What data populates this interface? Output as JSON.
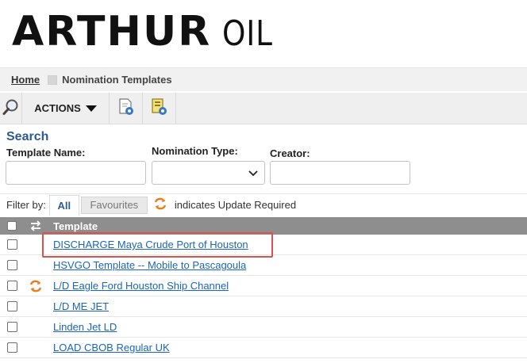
{
  "brand": {
    "part1": "ARTHUR",
    "part2": "OIL"
  },
  "breadcrumb": {
    "home": "Home",
    "current": "Nomination Templates"
  },
  "toolbar": {
    "actions_label": "ACTIONS"
  },
  "search": {
    "title": "Search",
    "template_name_label": "Template Name:",
    "template_name_value": "",
    "nomination_type_label": "Nomination Type:",
    "nomination_type_value": "",
    "creator_label": "Creator:",
    "creator_value": ""
  },
  "filter": {
    "label": "Filter by:",
    "all": "All",
    "favourites": "Favourites",
    "legend_text": "indicates Update Required"
  },
  "grid": {
    "column_template": "Template",
    "rows": [
      {
        "name": "DISCHARGE Maya Crude Port of Houston",
        "update_required": false
      },
      {
        "name": "HSVGO Template -- Mobile to Pascagoula",
        "update_required": false
      },
      {
        "name": "L/D Eagle Ford Houston Ship Channel",
        "update_required": true
      },
      {
        "name": "L/D ME JET",
        "update_required": false
      },
      {
        "name": "Linden Jet LD",
        "update_required": false
      },
      {
        "name": "LOAD CBOB Regular UK",
        "update_required": false
      }
    ]
  },
  "colors": {
    "accent_blue": "#2d5b96",
    "link_blue": "#1a66b8",
    "grid_header": "#8e8e8e",
    "update_orange": "#e87f1e",
    "highlight_red": "#d9534f"
  },
  "icons": [
    "search-icon",
    "chevron-down-icon",
    "settings-doc-icon",
    "settings-folder-icon",
    "update-required-icon"
  ]
}
